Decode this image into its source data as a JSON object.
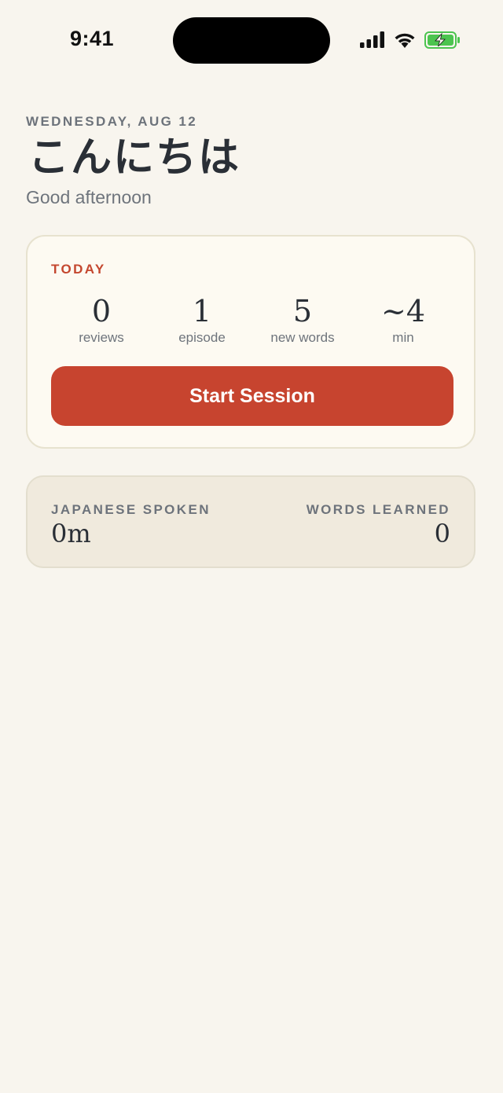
{
  "status_bar": {
    "time": "9:41",
    "icons": [
      "cellular-signal-icon",
      "wifi-icon",
      "battery-charging-icon"
    ],
    "battery_color": "#4cc44f"
  },
  "header": {
    "date": "WEDNESDAY, AUG 12",
    "greeting_jp": "こんにちは",
    "greeting_en": "Good afternoon"
  },
  "today": {
    "label": "TODAY",
    "stats": [
      {
        "value": "0",
        "label": "reviews"
      },
      {
        "value": "1",
        "label": "episode"
      },
      {
        "value": "5",
        "label": "new words"
      },
      {
        "value": "~4",
        "label": "min"
      }
    ],
    "button_label": "Start Session"
  },
  "totals": {
    "spoken_label": "JAPANESE SPOKEN",
    "spoken_value": "0m",
    "words_label": "WORDS LEARNED",
    "words_value": "0"
  },
  "colors": {
    "accent": "#c7442f",
    "background": "#f8f5ee",
    "card": "#fdfaf2",
    "totals_card": "#f0eadd"
  }
}
